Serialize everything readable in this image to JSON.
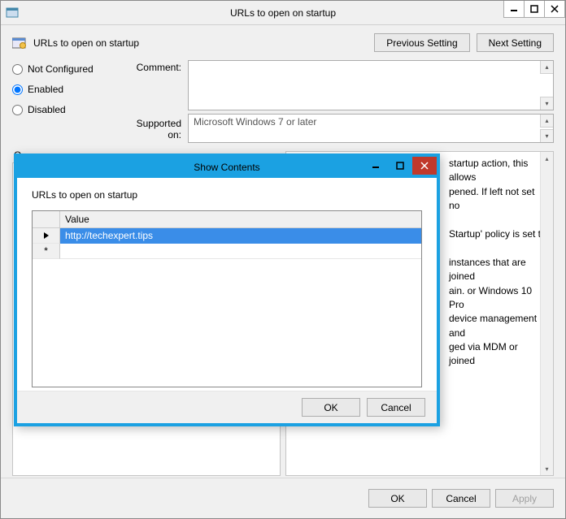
{
  "window": {
    "title": "URLs to open on startup"
  },
  "header": {
    "page_title": "URLs to open on startup",
    "prev_label": "Previous Setting",
    "next_label": "Next Setting"
  },
  "state": {
    "not_configured_label": "Not Configured",
    "enabled_label": "Enabled",
    "disabled_label": "Disabled",
    "selected": "enabled"
  },
  "fields": {
    "comment_label": "Comment:",
    "comment_value": "",
    "supported_label": "Supported on:",
    "supported_value": "Microsoft Windows 7 or later"
  },
  "panels": {
    "options_legend": "O",
    "help_legend": "",
    "help_text": "startup action, this allows\npened. If left not set no\n\nStartup' policy is set to\n\ninstances that are joined\nain. or Windows 10 Pro\ndevice management and\nged via MDM or joined"
  },
  "buttons": {
    "ok": "OK",
    "cancel": "Cancel",
    "apply": "Apply"
  },
  "dialog": {
    "title": "Show Contents",
    "caption": "URLs to open on startup",
    "col_header": "Value",
    "rows": [
      {
        "value": "http://techexpert.tips",
        "selected": true,
        "current": true
      },
      {
        "value": "",
        "new": true
      }
    ],
    "ok": "OK",
    "cancel": "Cancel"
  }
}
